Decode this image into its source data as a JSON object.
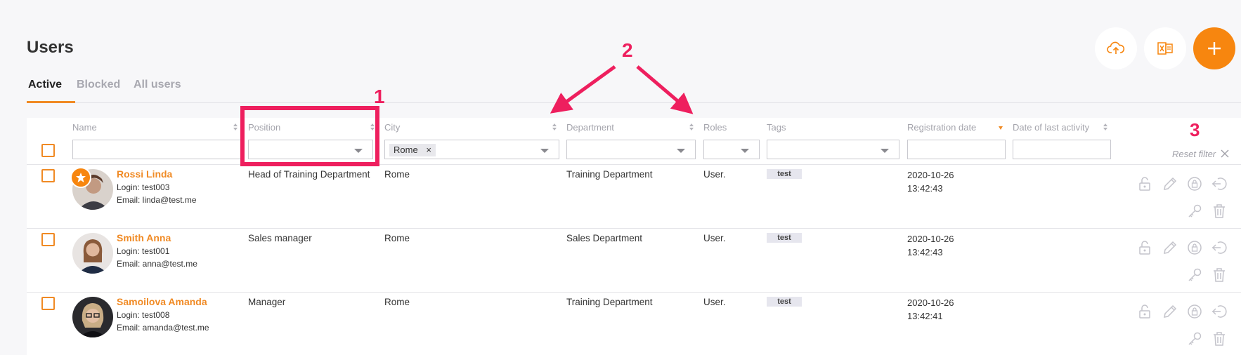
{
  "header": {
    "title": "Users",
    "actions": [
      {
        "name": "upload-button",
        "icon": "cloud-upload-icon"
      },
      {
        "name": "excel-export-button",
        "icon": "excel-icon"
      },
      {
        "name": "add-button",
        "icon": "plus-icon"
      }
    ]
  },
  "tabs": [
    {
      "label": "Active",
      "active": true
    },
    {
      "label": "Blocked",
      "active": false
    },
    {
      "label": "All users",
      "active": false
    }
  ],
  "columns": {
    "name": "Name",
    "position": "Position",
    "city": "City",
    "department": "Department",
    "roles": "Roles",
    "tags": "Tags",
    "registration_date": "Registration date",
    "last_activity": "Date of last activity"
  },
  "filters": {
    "name": "",
    "position": "",
    "city_chip": "Rome",
    "city_chip_remove": "×",
    "department": "",
    "roles": "",
    "tags": "",
    "registration_date": "",
    "last_activity": ""
  },
  "reset_filter_label": "Reset filter",
  "annotations": {
    "one": "1",
    "two": "2",
    "three": "3"
  },
  "users": [
    {
      "name": "Rossi Linda",
      "login": "Login: test003",
      "email": "Email: linda@test.me",
      "position": "Head of Training Department",
      "city": "Rome",
      "department": "Training Department",
      "roles": "User.",
      "tag": "test",
      "reg_date": "2020-10-26",
      "reg_time": "13:42:43",
      "starred": true
    },
    {
      "name": "Smith Anna",
      "login": "Login: test001",
      "email": "Email: anna@test.me",
      "position": "Sales manager",
      "city": "Rome",
      "department": "Sales Department",
      "roles": "User.",
      "tag": "test",
      "reg_date": "2020-10-26",
      "reg_time": "13:42:43",
      "starred": false
    },
    {
      "name": "Samoilova Amanda",
      "login": "Login: test008",
      "email": "Email: amanda@test.me",
      "position": "Manager",
      "city": "Rome",
      "department": "Training Department",
      "roles": "User.",
      "tag": "test",
      "reg_date": "2020-10-26",
      "reg_time": "13:42:41",
      "starred": false
    }
  ],
  "row_actions": [
    "unlock-icon",
    "edit-icon",
    "user-lock-icon",
    "login-as-icon",
    "key-icon",
    "trash-icon"
  ],
  "colors": {
    "accent": "#f7860f",
    "annotation": "#ee1f5e"
  }
}
